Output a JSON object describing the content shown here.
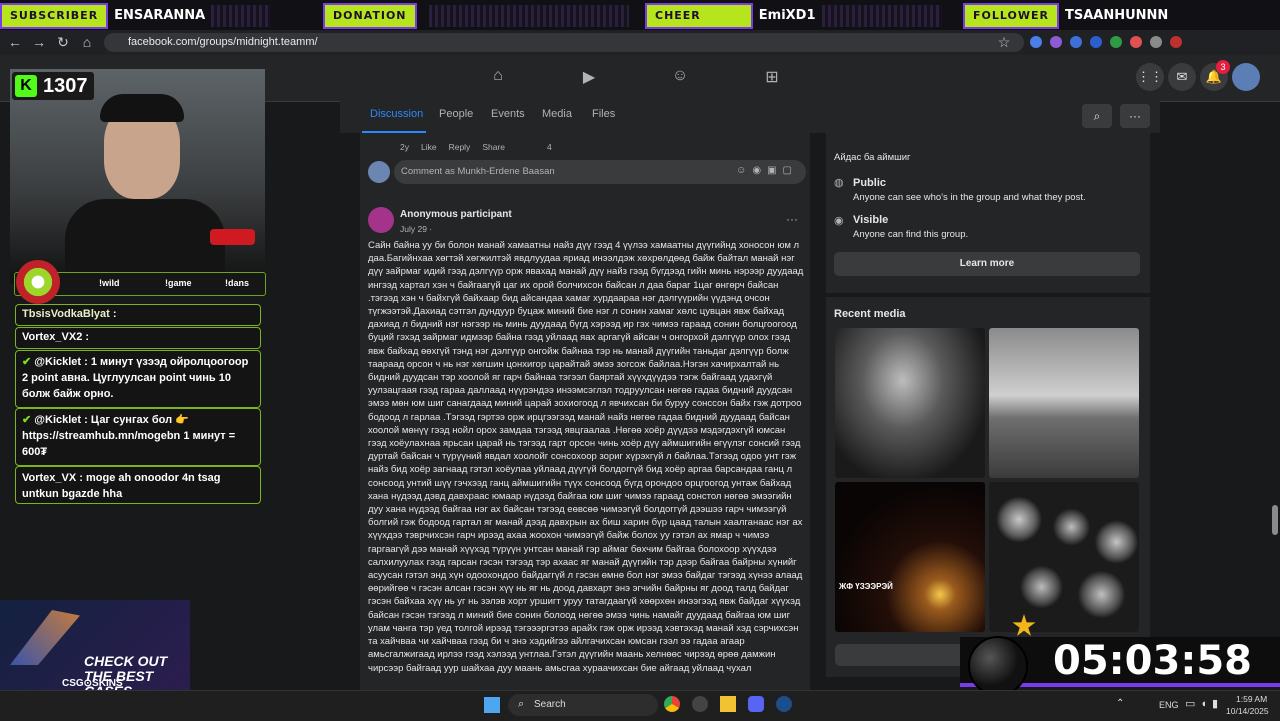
{
  "alerts": [
    {
      "label": "SUBSCRIBER",
      "name": "ENSARANNA"
    },
    {
      "label": "DONATION",
      "name": ""
    },
    {
      "label": "CHEER",
      "name": "EmiXD1"
    },
    {
      "label": "FOLLOWER",
      "name": "TSAANHUNNN"
    }
  ],
  "browser": {
    "url": "facebook.com/groups/midnight.teamm/"
  },
  "stream": {
    "kick_count": "1307",
    "chat_cmds": [
      "!wild",
      "!game",
      "!dans"
    ],
    "chat": [
      {
        "user": "TbsisVodkaBlyat",
        "text": ":"
      },
      {
        "user": "Vortex_VX2",
        "text": ":"
      },
      {
        "user": "@Kicklet",
        "text": ": 1 минут үзээд ойролцоогоор 2 point авна. Цуглуулсан point чинь 10 болж байж орно."
      },
      {
        "user": "@Kicklet",
        "text": ": Цаг сунгах бол 👉 https://streamhub.mn/mogebn 1 минут = 600₮"
      },
      {
        "user": "Vortex_VX",
        "text": ": moge ah onoodor 4n tsag untkun bgazde hha"
      }
    ],
    "ad_text": "CHECK OUT THE BEST CASES",
    "ad_brand": "CSG⊙SKINS",
    "timer": "05:03:58"
  },
  "fb": {
    "tabs": [
      "Discussion",
      "People",
      "Events",
      "Media",
      "Files"
    ],
    "comment_meta": {
      "time": "2y",
      "like": "Like",
      "reply": "Reply",
      "share": "Share",
      "reactions": "4"
    },
    "comment_placeholder": "Comment as Munkh-Erdene Baasan",
    "post_author": "Anonymous participant",
    "post_date": "July 29 · ",
    "post_body": "Сайн байна уу би болон манай хамаатны найз дүү гээд 4 үүлээ  хамаатны дүүгийнд  хоносон юм л даа.Багийнхаа хөгтэй хөгжилтэй явдлуудаа яриад инээлдэж хөхрөлдөөд байж байтал манай нэг дүү зайрмаг идий гээд дэлгүүр орж явахад манай дүү  найз гээд бүгдээд гийн минь нэрээр дуудаад ингээд хартал хэн ч байгаагүй цаг их орой болчихсон байсан л даа бараг 1цаг өнгөрч байсан .тэгээд хэн ч байхгүй байхаар бид айсандаа хамаг хурдаараа нэг дэлгүүрийн үүдэнд очсон түгжээтэй.Дахиад сэтгэл дундуур буцаж миний бие нэг л сонин хамаг хөлс цувцан явж байхад дахиад л бидний нэг нэгээр нь минь дуудаад бүгд хэрээд ир гэх чимээ гараад сонин болцгоогоод буций гэхэд зайрмаг идмээр байна гээд уйлаад яах аргагүй айсан ч онгорхой дэлгүүр олох гээд явж байхад өөхгүй тэнд нэг дэлгүүр онгойж байнаа тэр нь манай дүүгийн таньдаг дэлгүүр болж таараад орсон ч нь нэг хөгшин цонхигор царайтай эмээ зогсож байлаа.Нэгэн хачирхалтай нь бидний дуудсан тэр хоолой яг гарч байнаа тэгээл баяртай хүүхдүүдээ тэгж байгаад удахгүй уулзацгаая гээд гараа даллаад нүүрэндээ инээмсэглэл тодруулсан нөгөө гадаа бидний дуудсан эмээ мөн юм шиг санагдаад миний царай зохиогоод л явчихсан  би буруу сонссон байх гэж дотроо бодоод  л гарлаа .Тэгээд гэртээ орж ирцгээгээд манай найз нөгөө гадаа бидний дуудаад байсан хоолой мөнүү гээд нойл орох замдаа тэгээд явцгаалаа .Нөгөө хоёр дүүдээ мэдэгдэхгүй юмсан гээд хоёулахнаа ярьсан царай нь тэгээд гарт орсон чинь хоёр дүү аймшигийн өгүүлэг сонсий гээд дуртай байсан ч түрүүний явдал хоолойг сонсохоор зориг хүрэхгүй л байлаа.Тэгээд одоо унт гэж найз бид хоёр загнаад гэтэл хоёулаа уйлаад дүүгүй болдоггүй бид хоёр аргаа  барсандаа ганц л сонсоод унтий шүү гэчхээд ганц аймшигийн түүх сонсоод бүгд орондоо орцгоогод унтаж байхад хана нүдээд дэвд давхраас юмаар нүдээд байгаа юм шиг чимээ гараад сонстол нөгөө эмээгийн дуу хана нүдээд байгаа нэг ах байсан тэгээд еөвсөө чимээгүй болдоггүй дээшээ гарч чимээгүй болгий гэж бодоод гартал яг манай дээд давхрын ах биш харин бүр цаад талын хаалганаас нэг ах хүүхдээ тэврчихсэн гарч ирээд ахаа жоохон чимээгүй байж болох уу гэтэл ах ямар ч чимээ гаргаагүй дээ манай хүүхэд түрүүн унтсан манай гэр аймаг бөхчим байгаа болохоор хүүхдээ салхилуулах гээд гарсан гэсэн тэгээд тэр ахаас яг манай дүүгийн  тэр дээр байгаа байрны хүнийг асуусан гэтэл энд хүн одоохондоо байдаггүй л гэсэн өмнө бол нэг эмээ байдаг тэгээд хүнээ алаад өөрийгөө ч гэсэн алсан гэсэн хүү нь яг нь доод давхарт энэ эгчийн байрны яг доод талд байдаг гэсэн байхаа хүү нь уг нь зэлэв хорт уршигт уруу татагдаагүй хөөрхөн инээгээд явж байдаг хүүхэд байсан гэсэн тэгээд л миний бие сонин болоод нөгөө эмээ чинь намайг дуудаад байгаа юм шиг улам чанга тэр үед толгой ирээд тэгэээргэтээ арайх гэж орж ирээд хэвтэхэд манай хэд сэрчихсэн та хайчваа чи хайчваа гээд би ч энэ хэдийгээ айлгачихсан юмсан гээл ээ гадаа агаар амьсгалжигаад ирлээ гээд хэлээд унтлаа.Гэтэл дүүгийн маань хелнөөс чирээд өрөө дамжин чирсээр байгаад уур шайхаа дуу маань амьсгаа хураачихсан  бие айгаад уйлаад чухал",
    "about_line": "Айдас ба аймшиг",
    "public_title": "Public",
    "public_desc": "Anyone can see who's in the group and what they post.",
    "visible_title": "Visible",
    "visible_desc": "Anyone can find this group.",
    "learn_more": "Learn more",
    "recent_media": "Recent media",
    "media_caption": "ЖФ ҮЗЭЭРЭЙ",
    "notif_count": "3"
  },
  "taskbar": {
    "search": "Search",
    "lang": "ENG",
    "time": "1:59 AM",
    "date": "10/14/2025"
  }
}
